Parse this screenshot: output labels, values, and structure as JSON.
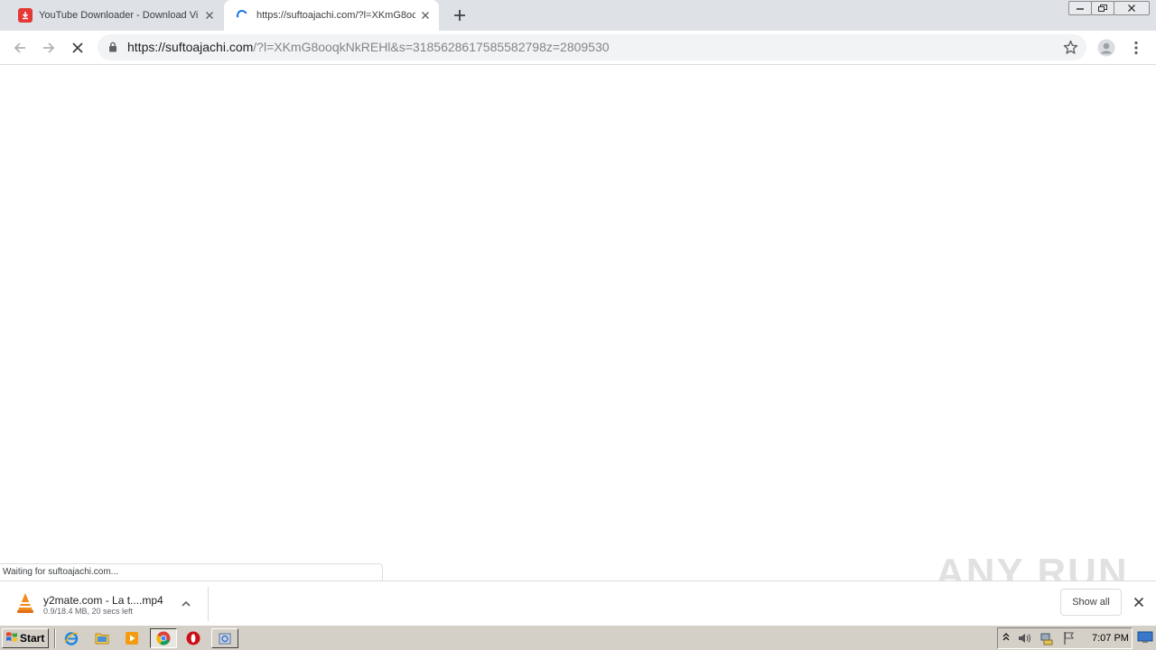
{
  "tabs": [
    {
      "title": "YouTube Downloader - Download Vid",
      "favicon": "download-icon"
    },
    {
      "title": "https://suftoajachi.com/?l=XKmG8oc",
      "favicon": "loading-spinner-icon",
      "active": true
    }
  ],
  "address": {
    "host": "https://suftoajachi.com",
    "path": "/?l=XKmG8ooqkNkREHl&s=3185628617585582798z=2809530"
  },
  "status_text": "Waiting for suftoajachi.com...",
  "download": {
    "filename": "y2mate.com - La t....mp4",
    "progress": "0.9/18.4 MB, 20 secs left"
  },
  "shelf": {
    "show_all": "Show all"
  },
  "watermark": "ANY RUN",
  "taskbar": {
    "start_label": "Start",
    "clock": "7:07 PM"
  },
  "colors": {
    "accent": "#1a73e8",
    "yt_red": "#e53935",
    "taskbar": "#d4d0c8"
  }
}
